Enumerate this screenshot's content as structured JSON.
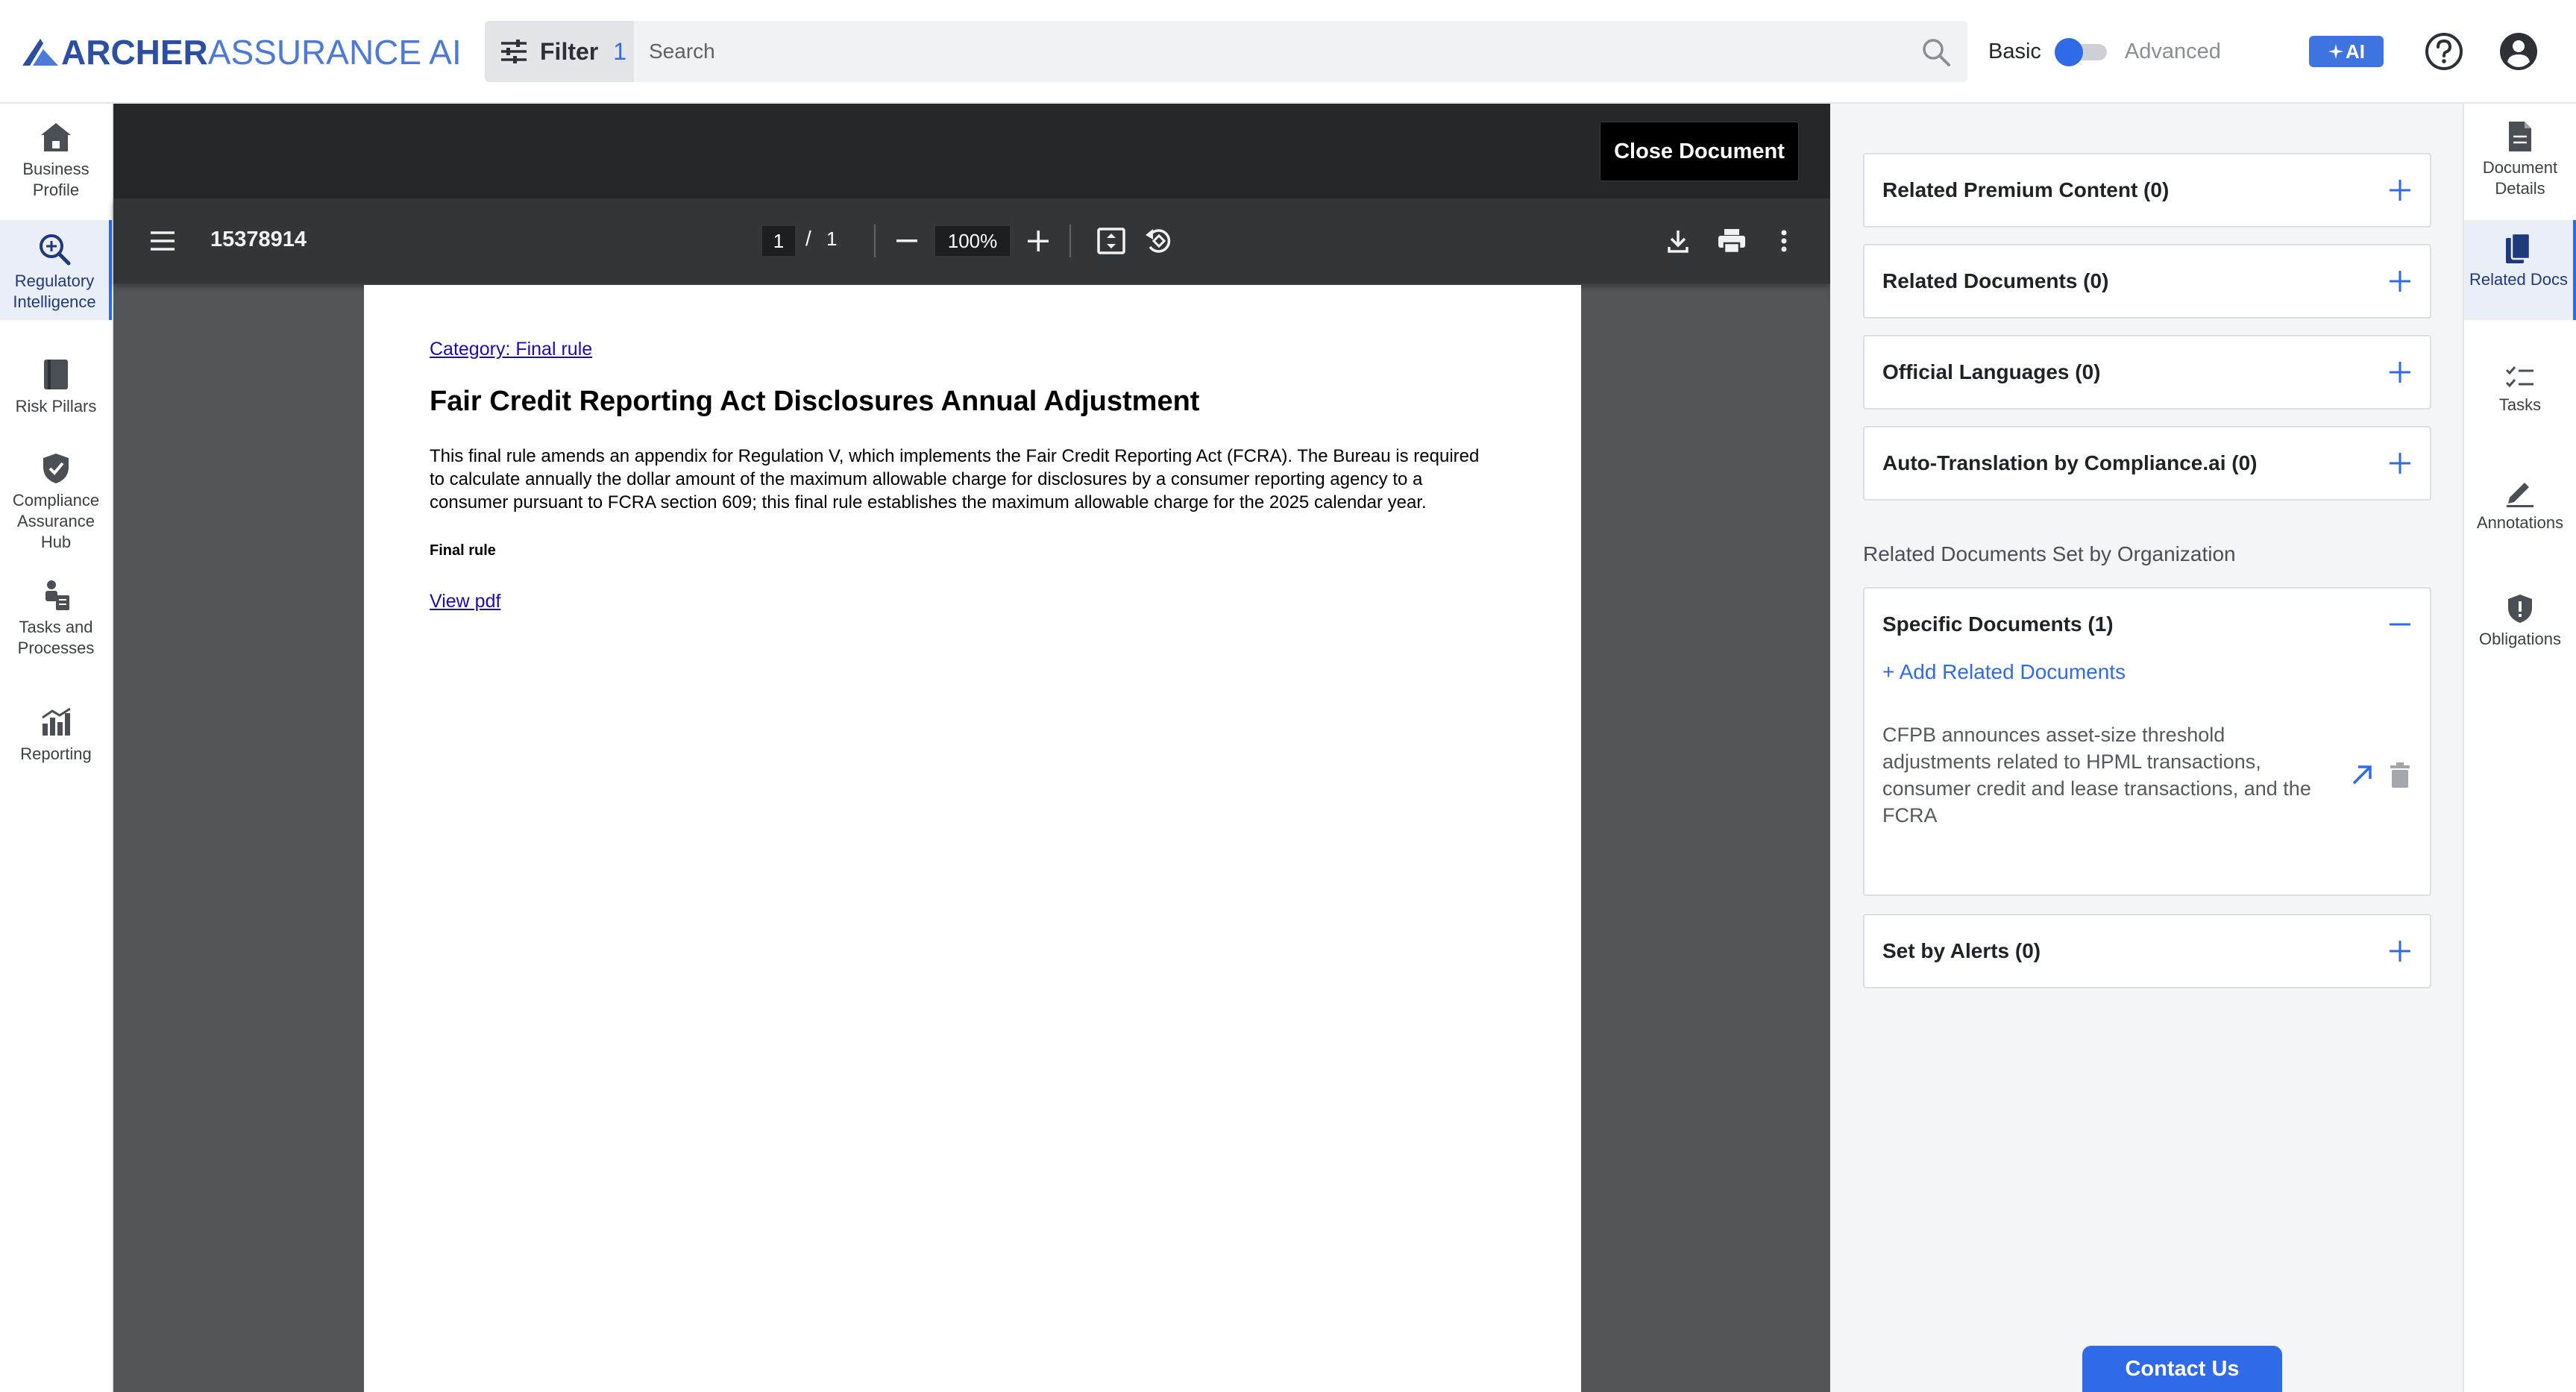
{
  "brand": {
    "name_bold": "ARCHER",
    "name_light": "ASSURANCE AI"
  },
  "header": {
    "filter_label": "Filter",
    "filter_count": "1",
    "search_placeholder": "Search",
    "mode_basic": "Basic",
    "mode_advanced": "Advanced",
    "mode_state": "basic",
    "ai_label": "AI"
  },
  "left_nav": [
    {
      "label": "Business Profile",
      "icon": "home-icon"
    },
    {
      "label": "Regulatory Intelligence",
      "icon": "search-zoom-icon",
      "active": true
    },
    {
      "label": "Risk Pillars",
      "icon": "book-icon"
    },
    {
      "label": "Compliance Assurance Hub",
      "icon": "shield-check-icon"
    },
    {
      "label": "Tasks and Processes",
      "icon": "tasks-person-icon"
    },
    {
      "label": "Reporting",
      "icon": "chart-icon"
    }
  ],
  "viewer": {
    "close_label": "Close Document",
    "file_name": "15378914",
    "page_current": "1",
    "page_separator": "/",
    "page_total": "1",
    "zoom": "100%"
  },
  "document": {
    "category": "Category: Final rule",
    "title": "Fair Credit Reporting Act Disclosures Annual Adjustment",
    "body": "This final rule amends an appendix for Regulation V, which implements the Fair Credit Reporting Act (FCRA). The Bureau is required to calculate annually the dollar amount of the maximum allowable charge for disclosures by a consumer reporting agency to a consumer pursuant to FCRA section 609; this final rule establishes the maximum allowable charge for the 2025 calendar year.",
    "tag": "Final rule",
    "link": "View pdf"
  },
  "right_panel": {
    "cards": [
      {
        "title": "Related Premium Content (0)"
      },
      {
        "title": "Related Documents (0)"
      },
      {
        "title": "Official Languages (0)"
      },
      {
        "title": "Auto-Translation by Compliance.ai (0)"
      }
    ],
    "org_section_label": "Related Documents Set by Organization",
    "specific": {
      "title": "Specific Documents (1)",
      "add_label": "+ Add Related Documents",
      "items": [
        {
          "text": "CFPB announces asset-size threshold adjustments related to HPML transactions, consumer credit and lease transactions, and the FCRA"
        }
      ]
    },
    "alerts": {
      "title": "Set by Alerts (0)"
    },
    "contact_label": "Contact Us"
  },
  "right_rail": [
    {
      "label": "Document Details",
      "icon": "document-icon"
    },
    {
      "label": "Related Docs",
      "icon": "related-docs-icon",
      "active": true
    },
    {
      "label": "Tasks",
      "icon": "checklist-icon"
    },
    {
      "label": "Annotations",
      "icon": "pencil-icon"
    },
    {
      "label": "Obligations",
      "icon": "shield-alert-icon"
    }
  ],
  "colors": {
    "accent": "#2f6be8",
    "brand_dark": "#2c4fa3",
    "viewer_bg": "#525659"
  }
}
